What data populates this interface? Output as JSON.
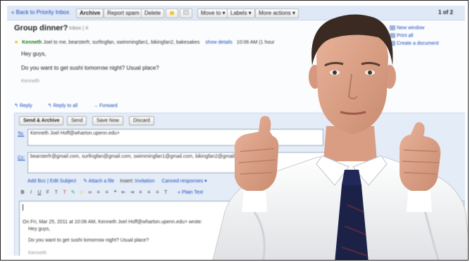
{
  "toolbar": {
    "back_link": "« Back to Priority Inbox",
    "archive": "Archive",
    "report_spam": "Report spam",
    "delete": "Delete",
    "move_to": "Move to ▾",
    "labels": "Labels ▾",
    "more_actions": "More actions ▾",
    "pager": "1 of 2"
  },
  "thread": {
    "subject": "Group dinner?",
    "subject_tag": "Inbox | X",
    "right_links": [
      "New window",
      "Print all",
      "Create a document"
    ]
  },
  "message": {
    "from": "Kenneth",
    "to": "Joel to me, bearsterfr, surfingfan, swimmingfan1, bikingfan2, bakesakes",
    "show_details": "show details",
    "time": "10:06 AM (1 hour",
    "greeting": "Hey guys,",
    "body": "Do you want to get sushi tomorrow night?  Usual place?",
    "signature": "Kenneth"
  },
  "reply_links": {
    "reply": "Reply",
    "reply_all": "Reply to all",
    "forward": "Forward"
  },
  "compose": {
    "send_archive": "Send & Archive",
    "send": "Send",
    "save_now": "Save Now",
    "discard": "Discard",
    "to_label": "To:",
    "to_value": "Kenneth Joel Hoff@wharton.upenn.edu>",
    "cc_label": "Cc:",
    "cc_value": "bearsterfr@gmail.com, surfingfan@gmail.com, swimmingfan1@gmail.com, bikingfan2@gmail",
    "add_bcc": "Add Bcc | Edit Subject",
    "attach": "Attach a file",
    "insert": "Insert:",
    "invitation": "Invitation",
    "canned": "Canned responses ▾",
    "plain_text": "« Plain Text",
    "quote_header": "On Fri, Mar 25, 2011 at 10:06 AM, Kenneth Joel Hoff@wharton.upenn.edu> wrote:",
    "quote_greeting": "Hey guys,",
    "quote_body": "Do you want to get sushi tomorrow night?  Usual place?",
    "quote_sig": "Kenneth"
  },
  "colors": {
    "toolbar_bg": "#dfe8f6",
    "compose_bg": "#e4ecf7",
    "link": "#1d4ebd",
    "sender": "#1a7a1a",
    "tie": "#1c2147",
    "shirt": "#f1f2f3"
  }
}
